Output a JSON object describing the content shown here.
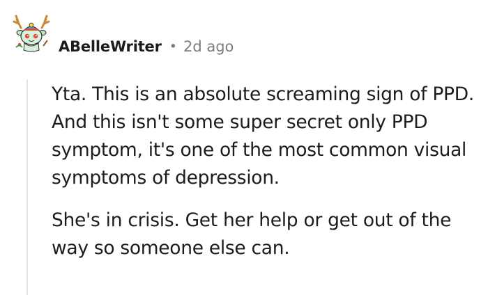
{
  "comment": {
    "author": "ABelleWriter",
    "separator": "•",
    "timestamp": "2d ago",
    "avatar_icon": "snoo-reindeer-avatar-icon",
    "paragraphs": [
      "Yta. This is an absolute screaming sign of PPD. And this isn't some super secret only PPD symptom, it's one of the most common visual symptoms of depression.",
      "She's in crisis. Get her help or get out of the way so someone else can."
    ]
  }
}
